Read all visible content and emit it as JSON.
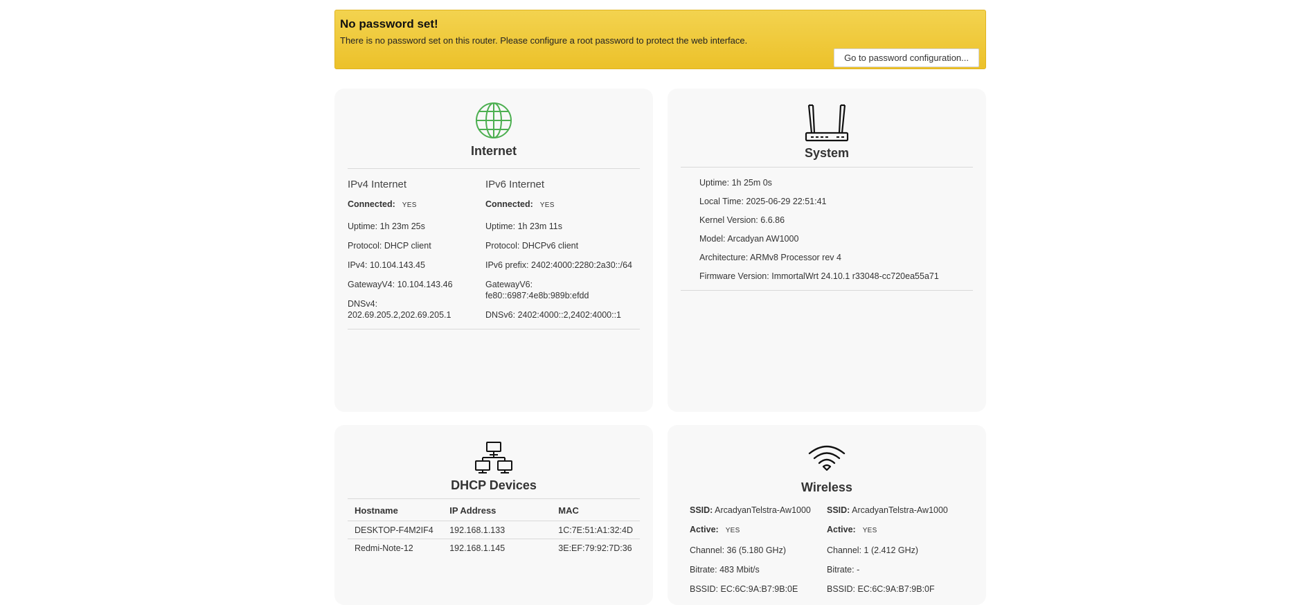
{
  "alert": {
    "title": "No password set!",
    "message": "There is no password set on this router. Please configure a root password to protect the web interface.",
    "button_label": "Go to password configuration..."
  },
  "internet": {
    "title": "Internet",
    "ipv4": {
      "heading": "IPv4 Internet",
      "connected_label": "Connected:",
      "connected_value": "YES",
      "uptime_label": "Uptime:",
      "uptime_value": "1h 23m 25s",
      "protocol_label": "Protocol:",
      "protocol_value": "DHCP client",
      "addr_label": "IPv4:",
      "addr_value": "10.104.143.45",
      "gateway_label": "GatewayV4:",
      "gateway_value": "10.104.143.46",
      "dns_label": "DNSv4:",
      "dns_value": "202.69.205.2,202.69.205.1"
    },
    "ipv6": {
      "heading": "IPv6 Internet",
      "connected_label": "Connected:",
      "connected_value": "YES",
      "uptime_label": "Uptime:",
      "uptime_value": "1h 23m 11s",
      "protocol_label": "Protocol:",
      "protocol_value": "DHCPv6 client",
      "prefix_label": "IPv6 prefix:",
      "prefix_value": "2402:4000:2280:2a30::/64",
      "gateway_label": "GatewayV6:",
      "gateway_value": "fe80::6987:4e8b:989b:efdd",
      "dns_label": "DNSv6:",
      "dns_value": "2402:4000::2,2402:4000::1"
    }
  },
  "system": {
    "title": "System",
    "rows": [
      {
        "label": "Uptime:",
        "value": "1h 25m 0s"
      },
      {
        "label": "Local Time:",
        "value": "2025-06-29 22:51:41"
      },
      {
        "label": "Kernel Version:",
        "value": "6.6.86"
      },
      {
        "label": "Model:",
        "value": "Arcadyan AW1000"
      },
      {
        "label": "Architecture:",
        "value": "ARMv8 Processor rev 4"
      },
      {
        "label": "Firmware Version:",
        "value": "ImmortalWrt 24.10.1 r33048-cc720ea55a71"
      }
    ]
  },
  "dhcp": {
    "title": "DHCP Devices",
    "columns": [
      "Hostname",
      "IP Address",
      "MAC"
    ],
    "rows": [
      [
        "DESKTOP-F4M2IF4",
        "192.168.1.133",
        "1C:7E:51:A1:32:4D"
      ],
      [
        "Redmi-Note-12",
        "192.168.1.145",
        "3E:EF:79:92:7D:36"
      ]
    ]
  },
  "wireless": {
    "title": "Wireless",
    "radios": [
      {
        "ssid_label": "SSID:",
        "ssid_value": "ArcadyanTelstra-Aw1000",
        "active_label": "Active:",
        "active_value": "YES",
        "channel_label": "Channel:",
        "channel_value": "36 (5.180 GHz)",
        "bitrate_label": "Bitrate:",
        "bitrate_value": "483 Mbit/s",
        "bssid_label": "BSSID:",
        "bssid_value": "EC:6C:9A:B7:9B:0E"
      },
      {
        "ssid_label": "SSID:",
        "ssid_value": "ArcadyanTelstra-Aw1000",
        "active_label": "Active:",
        "active_value": "YES",
        "channel_label": "Channel:",
        "channel_value": "1 (2.412 GHz)",
        "bitrate_label": "Bitrate:",
        "bitrate_value": "-",
        "bssid_label": "BSSID:",
        "bssid_value": "EC:6C:9A:B7:9B:0F"
      }
    ]
  },
  "colors": {
    "alert_background": "#f0c93a",
    "card_background": "#f8f8f8",
    "globe_icon": "#4caf50"
  },
  "icons": [
    "globe-icon",
    "router-icon",
    "network-icon",
    "wifi-icon"
  ]
}
